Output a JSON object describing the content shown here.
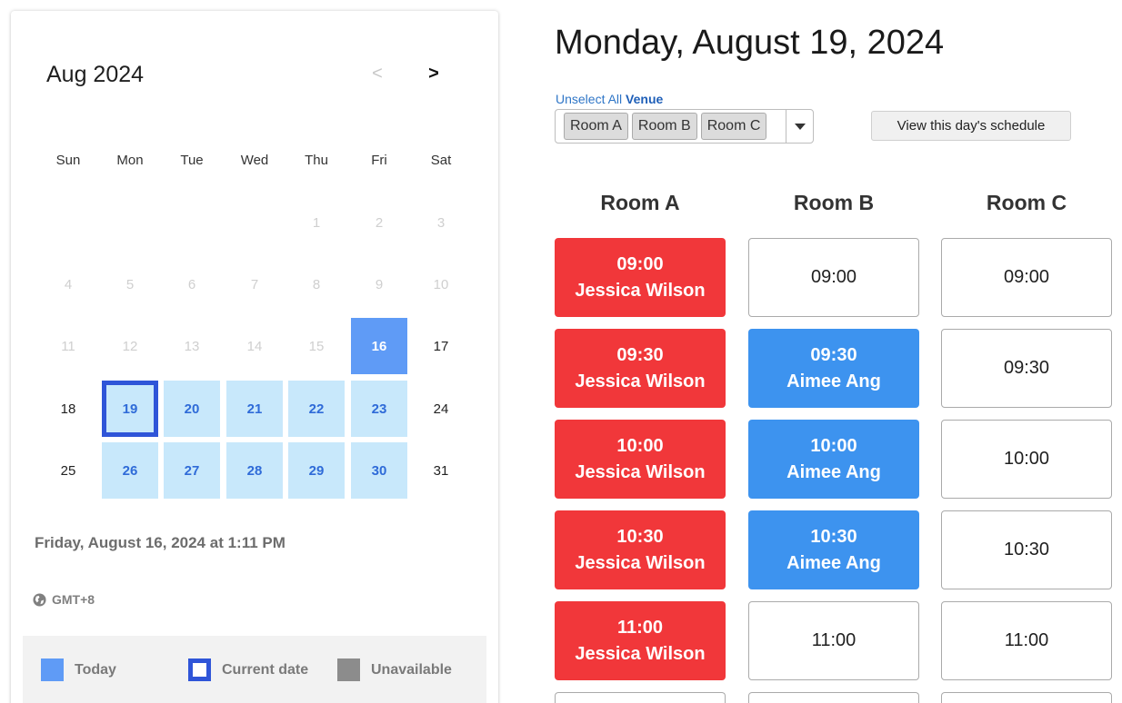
{
  "calendar": {
    "month_label": "Aug 2024",
    "prev_label": "<",
    "next_label": ">",
    "weekdays": [
      "Sun",
      "Mon",
      "Tue",
      "Wed",
      "Thu",
      "Fri",
      "Sat"
    ],
    "weeks": [
      [
        {
          "d": ""
        },
        {
          "d": ""
        },
        {
          "d": ""
        },
        {
          "d": ""
        },
        {
          "d": "1",
          "s": "disabled"
        },
        {
          "d": "2",
          "s": "disabled"
        },
        {
          "d": "3",
          "s": "disabled"
        }
      ],
      [
        {
          "d": "4",
          "s": "disabled"
        },
        {
          "d": "5",
          "s": "disabled"
        },
        {
          "d": "6",
          "s": "disabled"
        },
        {
          "d": "7",
          "s": "disabled"
        },
        {
          "d": "8",
          "s": "disabled"
        },
        {
          "d": "9",
          "s": "disabled"
        },
        {
          "d": "10",
          "s": "disabled"
        }
      ],
      [
        {
          "d": "11",
          "s": "disabled"
        },
        {
          "d": "12",
          "s": "disabled"
        },
        {
          "d": "13",
          "s": "disabled"
        },
        {
          "d": "14",
          "s": "disabled"
        },
        {
          "d": "15",
          "s": "disabled"
        },
        {
          "d": "16",
          "s": "today"
        },
        {
          "d": "17",
          "s": "normal"
        }
      ],
      [
        {
          "d": "18",
          "s": "normal"
        },
        {
          "d": "19",
          "s": "current"
        },
        {
          "d": "20",
          "s": "avail"
        },
        {
          "d": "21",
          "s": "avail"
        },
        {
          "d": "22",
          "s": "avail"
        },
        {
          "d": "23",
          "s": "avail"
        },
        {
          "d": "24",
          "s": "normal"
        }
      ],
      [
        {
          "d": "25",
          "s": "normal"
        },
        {
          "d": "26",
          "s": "avail"
        },
        {
          "d": "27",
          "s": "avail"
        },
        {
          "d": "28",
          "s": "avail"
        },
        {
          "d": "29",
          "s": "avail"
        },
        {
          "d": "30",
          "s": "avail"
        },
        {
          "d": "31",
          "s": "normal"
        }
      ]
    ],
    "current_datetime": "Friday, August 16, 2024 at 1:11 PM",
    "timezone": "GMT+8",
    "legend": {
      "today": "Today",
      "current": "Current date",
      "unavailable": "Unavailable"
    }
  },
  "schedule": {
    "title": "Monday, August 19, 2024",
    "filter": {
      "unselect_label": "Unselect All",
      "venue_label": "Venue",
      "selected_rooms": [
        "Room A",
        "Room B",
        "Room C"
      ]
    },
    "view_button": "View this day's schedule",
    "rooms": [
      {
        "name": "Room A",
        "slots": [
          {
            "time": "09:00",
            "booked_by": "Jessica Wilson",
            "status": "red"
          },
          {
            "time": "09:30",
            "booked_by": "Jessica Wilson",
            "status": "red"
          },
          {
            "time": "10:00",
            "booked_by": "Jessica Wilson",
            "status": "red"
          },
          {
            "time": "10:30",
            "booked_by": "Jessica Wilson",
            "status": "red"
          },
          {
            "time": "11:00",
            "booked_by": "Jessica Wilson",
            "status": "red"
          }
        ]
      },
      {
        "name": "Room B",
        "slots": [
          {
            "time": "09:00",
            "booked_by": "",
            "status": "free"
          },
          {
            "time": "09:30",
            "booked_by": "Aimee Ang",
            "status": "blue"
          },
          {
            "time": "10:00",
            "booked_by": "Aimee Ang",
            "status": "blue"
          },
          {
            "time": "10:30",
            "booked_by": "Aimee Ang",
            "status": "blue"
          },
          {
            "time": "11:00",
            "booked_by": "",
            "status": "free"
          }
        ]
      },
      {
        "name": "Room C",
        "slots": [
          {
            "time": "09:00",
            "booked_by": "",
            "status": "free"
          },
          {
            "time": "09:30",
            "booked_by": "",
            "status": "free"
          },
          {
            "time": "10:00",
            "booked_by": "",
            "status": "free"
          },
          {
            "time": "10:30",
            "booked_by": "",
            "status": "free"
          },
          {
            "time": "11:00",
            "booked_by": "",
            "status": "free"
          }
        ]
      }
    ]
  },
  "colors": {
    "booked_red": "#f1373a",
    "booked_blue": "#3d93ef",
    "today": "#5f9bf6",
    "available_day": "#c8e8fb",
    "current_border": "#2f55d8",
    "unavailable": "#8c8c8c",
    "link": "#2f76c7"
  }
}
